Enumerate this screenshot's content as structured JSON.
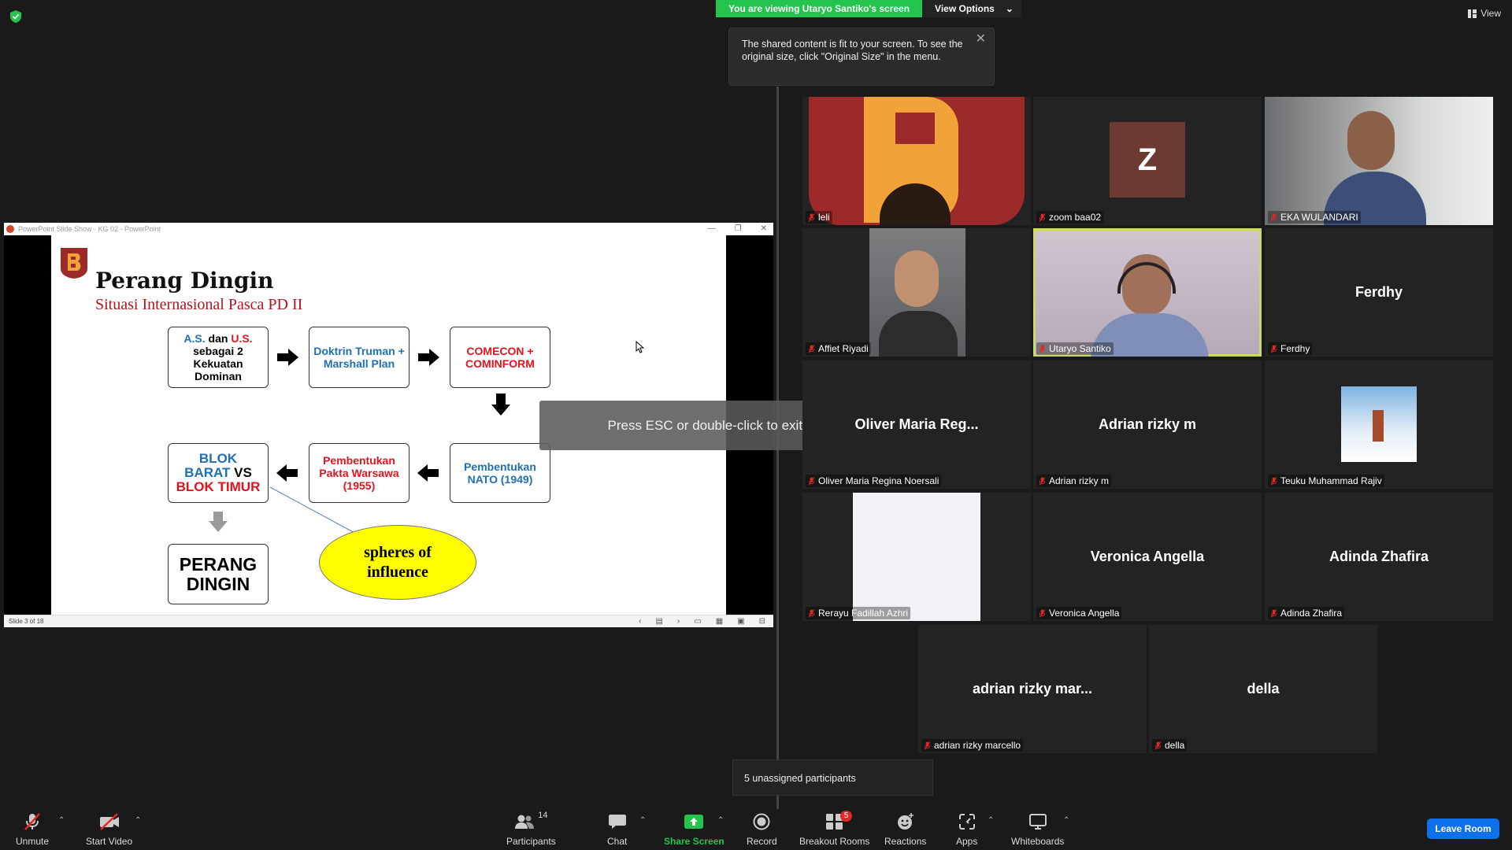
{
  "banner": {
    "viewing": "You are viewing Utaryo Santiko's screen",
    "view_options": "View Options"
  },
  "top_right": {
    "view_label": "View"
  },
  "tooltip": {
    "text": "The shared content is fit to your screen. To see the original size, click \"Original Size\" in the menu."
  },
  "ppt_window": {
    "title": "PowerPoint Slide Show - KG 02 - PowerPoint",
    "status": "Slide 3 of 18"
  },
  "slide": {
    "title": "Perang Dingin",
    "subtitle": "Situasi Internasional Pasca PD II",
    "box1": {
      "a": "A.S.",
      "dan": " dan ",
      "b": "U.S.",
      "rest": "sebagai 2 Kekuatan Dominan"
    },
    "box2": "Doktrin Truman + Marshall Plan",
    "box3": "COMECON + COMINFORM",
    "box4": "Pembentukan NATO (1949)",
    "box5": "Pembentukan Pakta Warsawa (1955)",
    "box6": {
      "l1": "BLOK",
      "l2a": "BARAT",
      "l2b": " VS",
      "l3": "BLOK TIMUR"
    },
    "box7": "PERANG DINGIN",
    "ellipse": "spheres of influence"
  },
  "fullscreen_overlay": "Press ESC or double-click to exit full screen mode",
  "participants": [
    {
      "name": "leli"
    },
    {
      "name": "zoom baa02",
      "avatar_letter": "Z"
    },
    {
      "name": "EKA WULANDARI"
    },
    {
      "name": "Affiet Riyadi"
    },
    {
      "name": "Utaryo Santiko"
    },
    {
      "name": "Ferdhy",
      "center": "Ferdhy"
    },
    {
      "name": "Oliver Maria Regina Noersali",
      "center": "Oliver Maria Reg..."
    },
    {
      "name": "Adrian rizky m",
      "center": "Adrian rizky m"
    },
    {
      "name": "Teuku Muhammad Rajiv"
    },
    {
      "name": "Rerayu Fadillah Azhri"
    },
    {
      "name": "Veronica Angella",
      "center": "Veronica Angella"
    },
    {
      "name": "Adinda Zhafira",
      "center": "Adinda Zhafira"
    },
    {
      "name": "adrian rizky marcello",
      "center": "adrian rizky mar..."
    },
    {
      "name": "della",
      "center": "della"
    }
  ],
  "unassigned": "5 unassigned participants",
  "toolbar": {
    "unmute": "Unmute",
    "start_video": "Start Video",
    "participants": "Participants",
    "participants_count": "14",
    "chat": "Chat",
    "share_screen": "Share Screen",
    "record": "Record",
    "breakout": "Breakout Rooms",
    "breakout_badge": "5",
    "reactions": "Reactions",
    "apps": "Apps",
    "whiteboards": "Whiteboards",
    "leave": "Leave Room"
  },
  "colors": {
    "share_green": "#23c34d",
    "leave_blue": "#0e71eb",
    "active_speaker": "#c9d86a"
  }
}
